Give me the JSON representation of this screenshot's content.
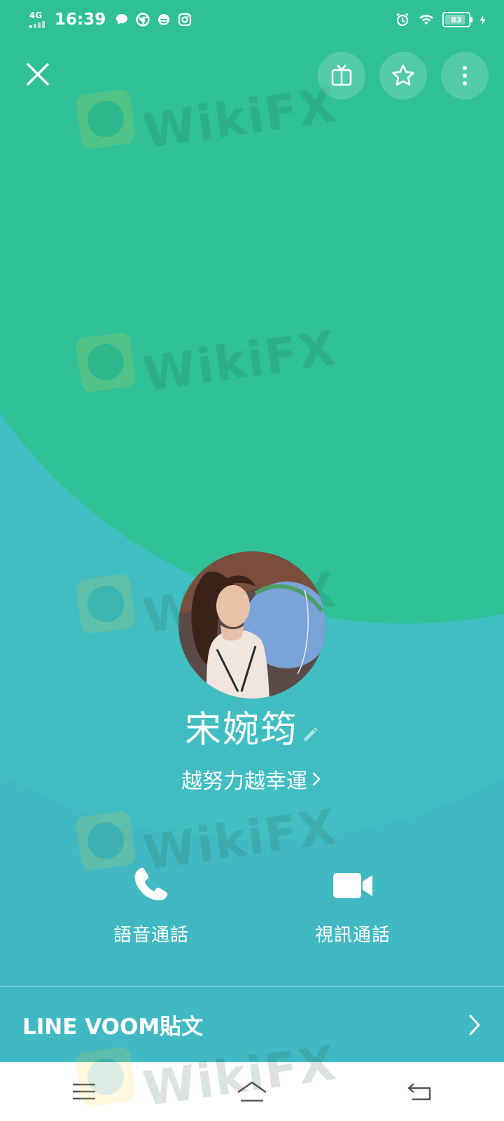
{
  "status_bar": {
    "network": "4G",
    "time": "16:39",
    "battery": "83",
    "icons": [
      "chat-bubble-icon",
      "chrome-icon",
      "browser-icon",
      "instagram-icon",
      "alarm-icon",
      "wifi-icon",
      "charging-icon"
    ]
  },
  "header": {
    "close_icon": "close-icon",
    "actions": [
      "tv-icon",
      "star-icon",
      "more-vertical-icon"
    ]
  },
  "profile": {
    "name": "宋婉筠",
    "status_message": "越努力越幸運"
  },
  "calls": {
    "voice_label": "語音通話",
    "video_label": "視訊通話"
  },
  "voom": {
    "label": "LINE VOOM貼文"
  },
  "watermark": {
    "text": "WikiFX"
  },
  "colors": {
    "green": "#2fc095",
    "teal": "#41b9c3",
    "nav_bg": "#ffffff"
  }
}
